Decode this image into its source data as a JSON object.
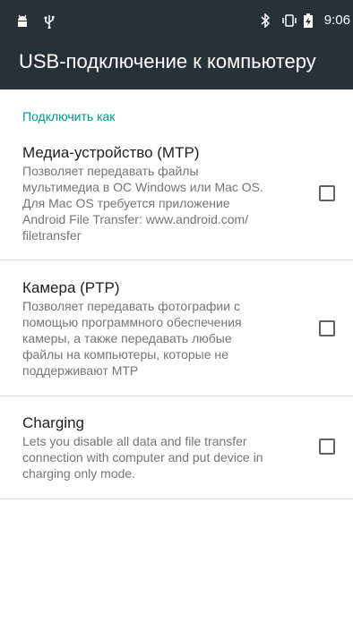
{
  "status_bar": {
    "time": "9:06",
    "left_icons": [
      "android-debug-icon",
      "usb-icon"
    ],
    "right_icons": [
      "bluetooth-icon",
      "vibrate-icon",
      "battery-charging-icon"
    ]
  },
  "app_bar": {
    "title": "USB-подключение к компьютеру"
  },
  "section": {
    "header": "Подключить как"
  },
  "options": [
    {
      "title": "Медиа-устройство (MTP)",
      "summary_lines": [
        "Позволяет передавать файлы",
        "мультимедиа в ОС Windows или Mac OS.",
        "Для Mac OS требуется приложение",
        "Android File Transfer: www.android.com/",
        "filetransfer"
      ],
      "checked": false
    },
    {
      "title": "Камера (PTP)",
      "summary_lines": [
        "Позволяет передавать фотографии с",
        "помощью программного обеспечения",
        "камеры, а также передавать любые",
        "файлы на компьютеры, которые не",
        "поддерживают MTP"
      ],
      "checked": false
    },
    {
      "title": "Charging",
      "summary_lines": [
        "Lets you disable all data and file transfer",
        "connection with computer and put device in",
        "charging only mode."
      ],
      "checked": false
    }
  ],
  "colors": {
    "toolbar": "#263238",
    "accent": "#009688",
    "title_text": "#212121",
    "summary_text": "#757575"
  }
}
